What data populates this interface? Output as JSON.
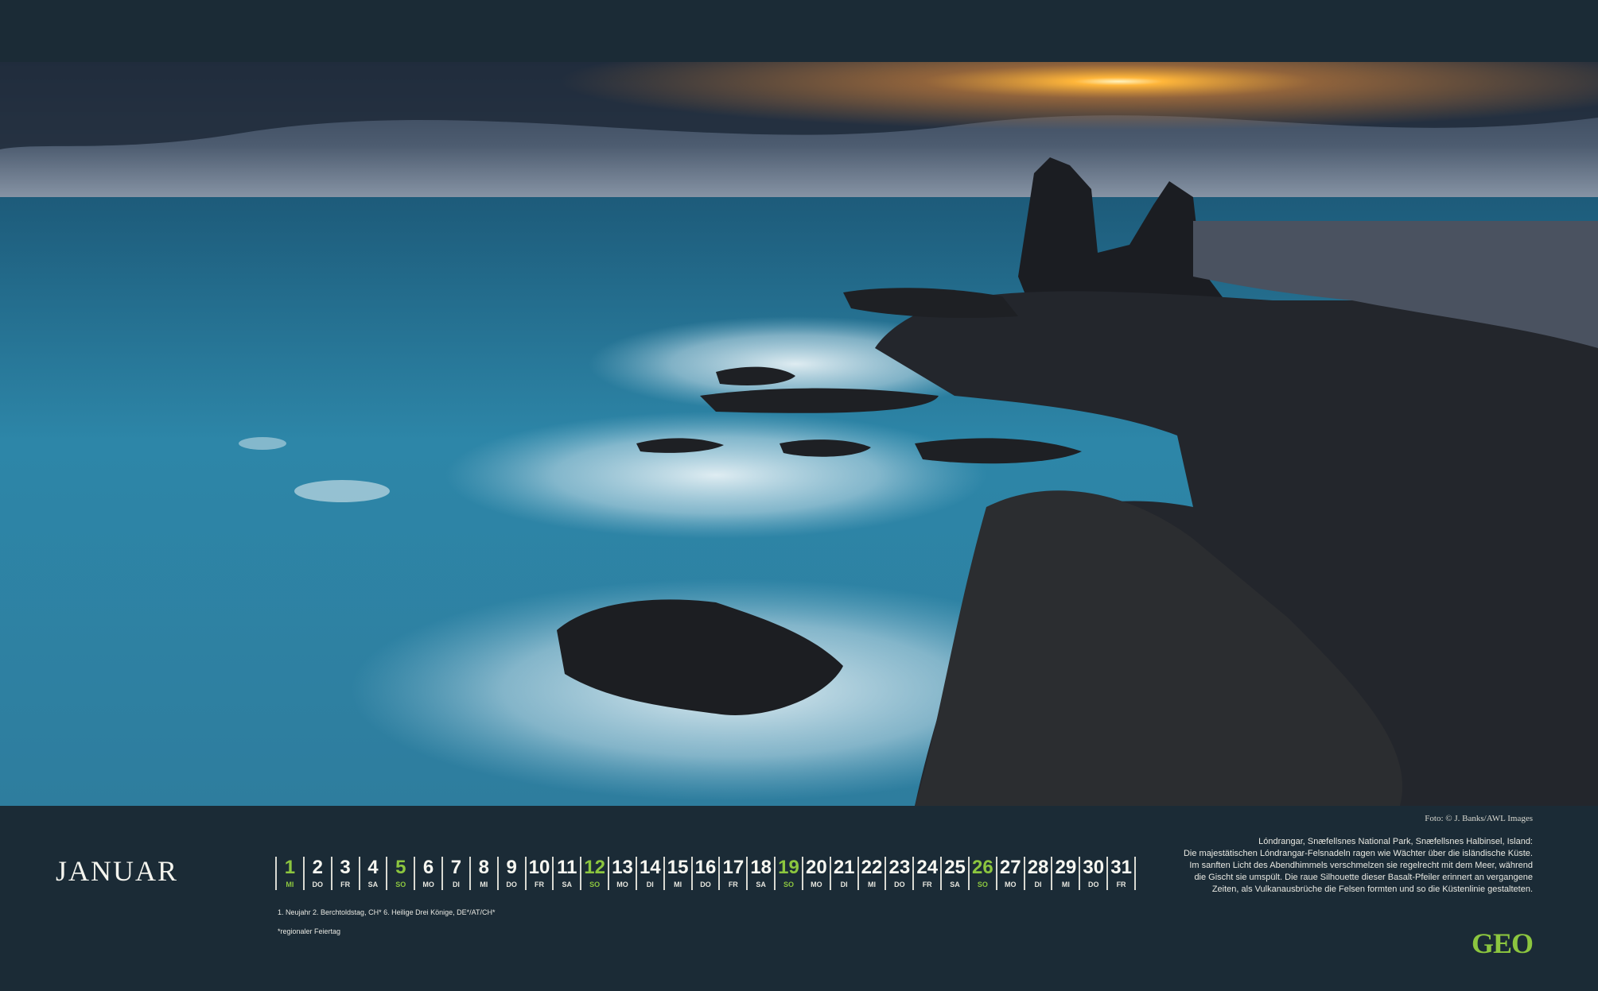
{
  "photo": {
    "credit": "Foto: © J. Banks/AWL Images"
  },
  "calendar": {
    "month": "JANUAR",
    "days": [
      {
        "num": "1",
        "wd": "MI",
        "green": true
      },
      {
        "num": "2",
        "wd": "DO",
        "green": false
      },
      {
        "num": "3",
        "wd": "FR",
        "green": false
      },
      {
        "num": "4",
        "wd": "SA",
        "green": false
      },
      {
        "num": "5",
        "wd": "SO",
        "green": true
      },
      {
        "num": "6",
        "wd": "MO",
        "green": false
      },
      {
        "num": "7",
        "wd": "DI",
        "green": false
      },
      {
        "num": "8",
        "wd": "MI",
        "green": false
      },
      {
        "num": "9",
        "wd": "DO",
        "green": false
      },
      {
        "num": "10",
        "wd": "FR",
        "green": false
      },
      {
        "num": "11",
        "wd": "SA",
        "green": false
      },
      {
        "num": "12",
        "wd": "SO",
        "green": true
      },
      {
        "num": "13",
        "wd": "MO",
        "green": false
      },
      {
        "num": "14",
        "wd": "DI",
        "green": false
      },
      {
        "num": "15",
        "wd": "MI",
        "green": false
      },
      {
        "num": "16",
        "wd": "DO",
        "green": false
      },
      {
        "num": "17",
        "wd": "FR",
        "green": false
      },
      {
        "num": "18",
        "wd": "SA",
        "green": false
      },
      {
        "num": "19",
        "wd": "SO",
        "green": true
      },
      {
        "num": "20",
        "wd": "MO",
        "green": false
      },
      {
        "num": "21",
        "wd": "DI",
        "green": false
      },
      {
        "num": "22",
        "wd": "MI",
        "green": false
      },
      {
        "num": "23",
        "wd": "DO",
        "green": false
      },
      {
        "num": "24",
        "wd": "FR",
        "green": false
      },
      {
        "num": "25",
        "wd": "SA",
        "green": false
      },
      {
        "num": "26",
        "wd": "SO",
        "green": true
      },
      {
        "num": "27",
        "wd": "MO",
        "green": false
      },
      {
        "num": "28",
        "wd": "DI",
        "green": false
      },
      {
        "num": "29",
        "wd": "MI",
        "green": false
      },
      {
        "num": "30",
        "wd": "DO",
        "green": false
      },
      {
        "num": "31",
        "wd": "FR",
        "green": false
      }
    ],
    "holidays": "1. Neujahr   2. Berchtoldstag, CH*   6. Heilige Drei Könige, DE*/AT/CH*",
    "footnote": "*regionaler Feiertag"
  },
  "caption": {
    "title": "Lóndrangar, Snæfellsnes National Park, Snæfellsnes Halbinsel, Island:",
    "line1": "Die majestätischen Lóndrangar-Felsnadeln ragen wie Wächter über die isländische Küste.",
    "line2": "Im sanften Licht des Abendhimmels verschmelzen sie regelrecht mit dem Meer, während",
    "line3": "die Gischt sie umspült. Die raue Silhouette dieser Basalt-Pfeiler erinnert an vergangene",
    "line4": "Zeiten, als Vulkanausbrüche die Felsen formten und so die Küstenlinie gestalteten."
  },
  "brand": {
    "logo": "GEO",
    "accent": "#8cc63f",
    "background": "#1b2b36"
  }
}
